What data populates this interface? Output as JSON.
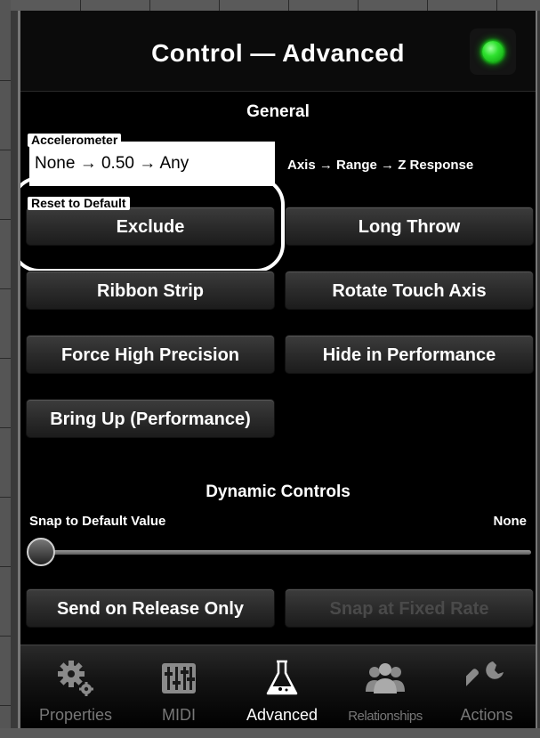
{
  "header": {
    "title": "Control — Advanced"
  },
  "general": {
    "section_title": "General",
    "accelerometer_tag": "Accelerometer",
    "accelerometer_value": "None → 0.50 → Any",
    "axis_label": "Axis → Range → Z Response",
    "reset_tag": "Reset to Default",
    "buttons": {
      "exclude": "Exclude",
      "long_throw": "Long Throw",
      "ribbon_strip": "Ribbon Strip",
      "rotate_touch_axis": "Rotate Touch Axis",
      "force_high_precision": "Force High Precision",
      "hide_in_performance": "Hide in Performance",
      "bring_up": "Bring Up (Performance)"
    }
  },
  "dynamic": {
    "section_title": "Dynamic Controls",
    "snap_label": "Snap to Default Value",
    "snap_value": "None",
    "slider_value": 0,
    "buttons": {
      "send_on_release": "Send on Release Only",
      "snap_fixed_rate": "Snap at Fixed Rate"
    }
  },
  "tabbar": {
    "tabs": [
      {
        "label": "Properties",
        "icon": "gears-icon",
        "active": false
      },
      {
        "label": "MIDI",
        "icon": "mixer-icon",
        "active": false
      },
      {
        "label": "Advanced",
        "icon": "flask-icon",
        "active": true
      },
      {
        "label": "Relationships",
        "icon": "people-icon",
        "active": false
      },
      {
        "label": "Actions",
        "icon": "wrench-icon",
        "active": false
      }
    ]
  },
  "colors": {
    "led": "#2fe22f",
    "background": "#000000",
    "inactive_tab": "#777777"
  }
}
